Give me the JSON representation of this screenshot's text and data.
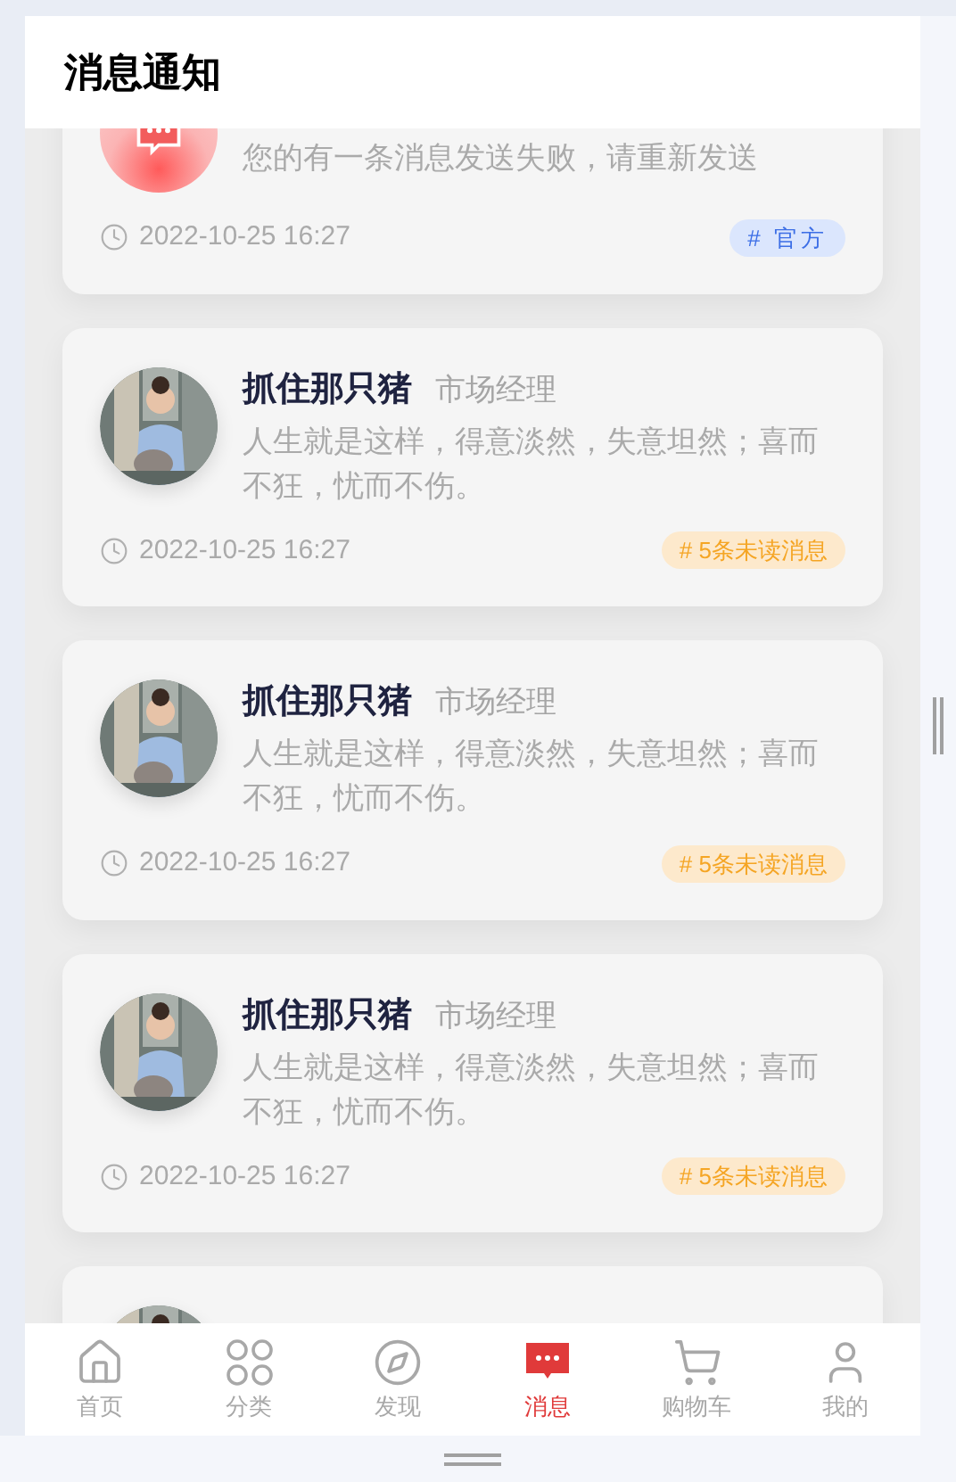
{
  "header": {
    "title": "消息通知"
  },
  "messages": [
    {
      "kind": "system",
      "text": "您的有一条消息发送失败，请重新发送",
      "time": "2022-10-25 16:27",
      "tag": {
        "kind": "official",
        "label": "# 官方"
      }
    },
    {
      "kind": "user",
      "name": "抓住那只猪",
      "role": "市场经理",
      "text": "人生就是这样，得意淡然，失意坦然；喜而不狂，忧而不伤。",
      "time": "2022-10-25 16:27",
      "tag": {
        "kind": "unread",
        "label": "# 5条未读消息"
      }
    },
    {
      "kind": "user",
      "name": "抓住那只猪",
      "role": "市场经理",
      "text": "人生就是这样，得意淡然，失意坦然；喜而不狂，忧而不伤。",
      "time": "2022-10-25 16:27",
      "tag": {
        "kind": "unread",
        "label": "# 5条未读消息"
      }
    },
    {
      "kind": "user",
      "name": "抓住那只猪",
      "role": "市场经理",
      "text": "人生就是这样，得意淡然，失意坦然；喜而不狂，忧而不伤。",
      "time": "2022-10-25 16:27",
      "tag": {
        "kind": "unread",
        "label": "# 5条未读消息"
      }
    },
    {
      "kind": "user"
    }
  ],
  "tab_bar": [
    {
      "label": "首页",
      "selected": false
    },
    {
      "label": "分类",
      "selected": false
    },
    {
      "label": "发现",
      "selected": false
    },
    {
      "label": "消息",
      "selected": true
    },
    {
      "label": "购物车",
      "selected": false
    },
    {
      "label": "我的",
      "selected": false
    }
  ]
}
